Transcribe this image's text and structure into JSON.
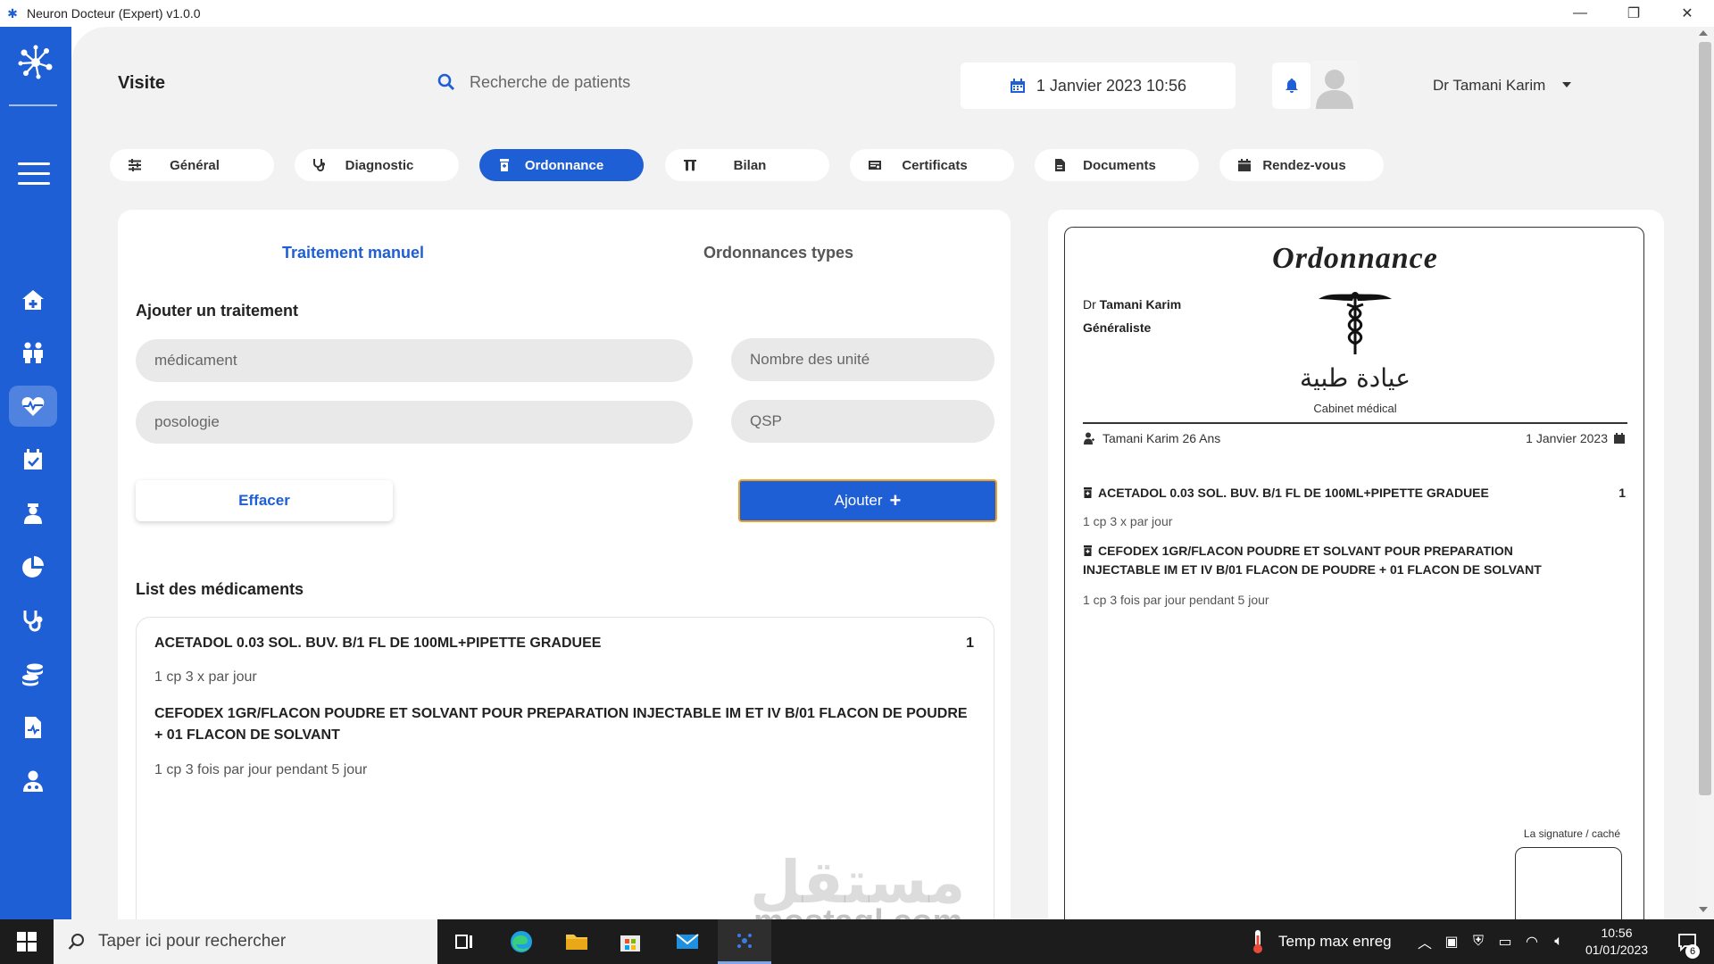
{
  "window": {
    "title": "Neuron Docteur (Expert) v1.0.0",
    "controls": {
      "minimize": "—",
      "maximize": "❐",
      "close": "✕"
    }
  },
  "theme": {
    "primary": "#1f5fd6",
    "accent_border": "#f0a020",
    "background": "#f2f2f2"
  },
  "sidebar": {
    "items": [
      {
        "name": "home",
        "icon": "home-icon"
      },
      {
        "name": "patients",
        "icon": "users-icon"
      },
      {
        "name": "visit",
        "icon": "heartbeat-icon",
        "active": true
      },
      {
        "name": "calendar",
        "icon": "calendar-check-icon"
      },
      {
        "name": "staff",
        "icon": "nurse-icon"
      },
      {
        "name": "statistics",
        "icon": "pie-chart-icon"
      },
      {
        "name": "stethoscope",
        "icon": "stethoscope-icon"
      },
      {
        "name": "finance",
        "icon": "coins-icon"
      },
      {
        "name": "reports",
        "icon": "file-medical-icon"
      },
      {
        "name": "doctor",
        "icon": "doctor-icon"
      }
    ]
  },
  "header": {
    "title": "Visite",
    "search_placeholder": "Recherche de patients",
    "datetime": "1 Janvier 2023 10:56",
    "user_name": "Dr Tamani Karim"
  },
  "tabs": [
    {
      "label": "Général",
      "icon": "sliders-icon"
    },
    {
      "label": "Diagnostic",
      "icon": "stethoscope-icon"
    },
    {
      "label": "Ordonnance",
      "icon": "prescription-bottle-icon",
      "active": true
    },
    {
      "label": "Bilan",
      "icon": "test-tubes-icon"
    },
    {
      "label": "Certificats",
      "icon": "certificate-icon"
    },
    {
      "label": "Documents",
      "icon": "file-icon"
    },
    {
      "label": "Rendez-vous",
      "icon": "calendar-icon"
    }
  ],
  "left_panel": {
    "subtabs": {
      "active": "Traitement manuel",
      "inactive": "Ordonnances types"
    },
    "form_title": "Ajouter un traitement",
    "fields": {
      "medicament_placeholder": "médicament",
      "units_placeholder": "Nombre des unité",
      "posologie_placeholder": "posologie",
      "qsp_placeholder": "QSP"
    },
    "clear_label": "Effacer",
    "add_label": "Ajouter",
    "list_title": "List des médicaments",
    "medications": [
      {
        "name": "ACETADOL 0.03 SOL. BUV. B/1 FL DE 100ML+PIPETTE GRADUEE",
        "qty": "1",
        "dose": "1 cp 3 x par jour"
      },
      {
        "name": "CEFODEX 1GR/FLACON POUDRE ET SOLVANT POUR PREPARATION INJECTABLE IM ET IV B/01 FLACON DE POUDRE + 01 FLACON DE SOLVANT",
        "qty": "",
        "dose": "1 cp 3 fois par jour pendant 5 jour"
      }
    ]
  },
  "prescription": {
    "title": "Ordonnance",
    "doctor_prefix": "Dr",
    "doctor_name": "Tamani Karim",
    "specialty": "Généraliste",
    "clinic_arabic": "عيادة طبية",
    "clinic_name": "Cabinet médical",
    "patient": "Tamani Karim 26 Ans",
    "date": "1 Janvier 2023",
    "items": [
      {
        "name": "ACETADOL 0.03 SOL. BUV. B/1 FL DE 100ML+PIPETTE GRADUEE",
        "qty": "1",
        "dose": "1 cp 3 x par jour"
      },
      {
        "name": "CEFODEX 1GR/FLACON POUDRE ET SOLVANT POUR PREPARATION INJECTABLE IM ET IV B/01 FLACON DE POUDRE + 01 FLACON DE SOLVANT",
        "qty": "",
        "dose": "1 cp 3 fois par jour pendant 5 jour"
      }
    ],
    "signature_label": "La signature / caché"
  },
  "taskbar": {
    "search_placeholder": "Taper ici pour rechercher",
    "weather": "Temp max enreg",
    "time": "10:56",
    "date": "01/01/2023",
    "notifications": "6",
    "apps": [
      {
        "name": "task-view",
        "icon": "task-view-icon"
      },
      {
        "name": "edge",
        "icon": "edge-icon"
      },
      {
        "name": "explorer",
        "icon": "folder-icon"
      },
      {
        "name": "store",
        "icon": "store-icon"
      },
      {
        "name": "mail",
        "icon": "mail-icon"
      },
      {
        "name": "neuron-docteur",
        "icon": "app-icon",
        "running": true
      }
    ]
  },
  "watermark": {
    "logo": "مستقل",
    "text": "mostaql.com"
  }
}
